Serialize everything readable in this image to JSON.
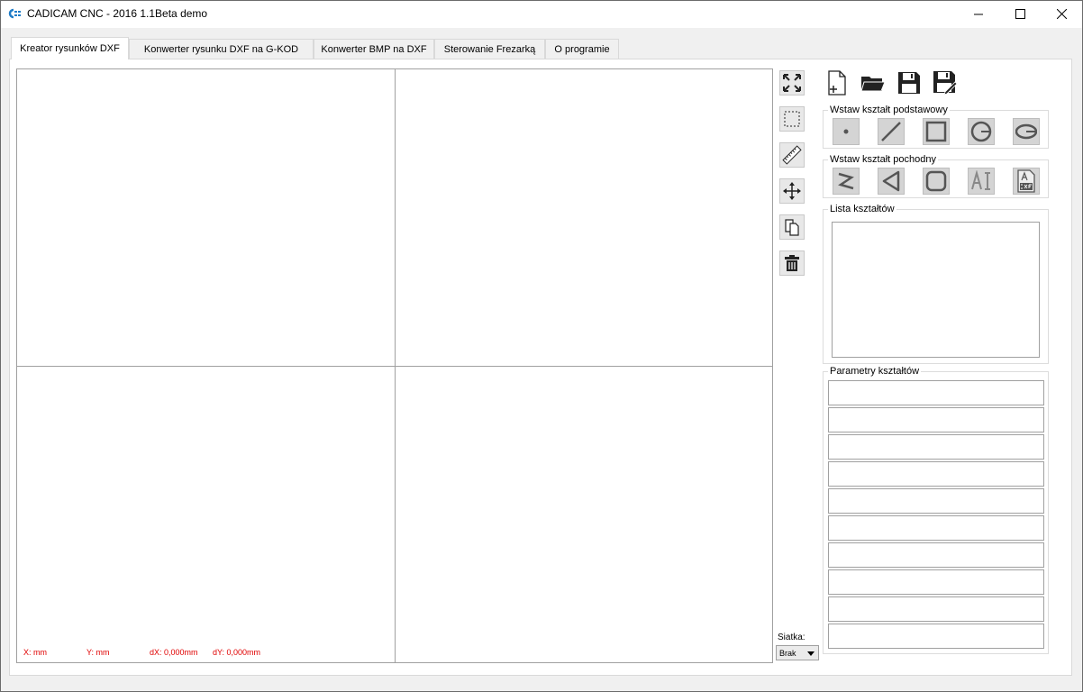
{
  "window": {
    "title": "CADICAM CNC - 2016 1.1Beta demo"
  },
  "tabs": [
    {
      "label": "Kreator rysunków DXF",
      "active": true
    },
    {
      "label": "Konwerter rysunku DXF na G-KOD",
      "active": false
    },
    {
      "label": "Konwerter BMP na DXF",
      "active": false
    },
    {
      "label": "Sterowanie Frezarką",
      "active": false
    },
    {
      "label": "O programie",
      "active": false
    }
  ],
  "canvas": {
    "x_label": "X: mm",
    "y_label": "Y: mm",
    "dx_label": "dX: 0,000mm",
    "dy_label": "dY: 0,000mm"
  },
  "view_tools": [
    "fit-view-icon",
    "select-area-icon",
    "measure-ruler-icon",
    "move-icon",
    "copy-icon",
    "delete-icon"
  ],
  "file_tools": [
    "new-file-icon",
    "open-folder-icon",
    "save-icon",
    "save-as-icon"
  ],
  "groups": {
    "basic_shapes": {
      "title": "Wstaw kształt podstawowy",
      "items": [
        "point-icon",
        "line-icon",
        "rectangle-icon",
        "circle-icon",
        "ellipse-icon"
      ]
    },
    "derived_shapes": {
      "title": "Wstaw kształt pochodny",
      "items": [
        "polyline-icon",
        "triangle-icon",
        "rounded-rectangle-icon",
        "text-icon",
        "dxf-import-icon"
      ]
    },
    "shape_list": {
      "title": "Lista kształtów"
    },
    "shape_params": {
      "title": "Parametry kształtów"
    }
  },
  "grid": {
    "label": "Siatka:",
    "value": "Brak"
  },
  "colors": {
    "coord_text": "#e00000",
    "border": "#a0a0a0",
    "window_bg": "#f0f0f0"
  }
}
